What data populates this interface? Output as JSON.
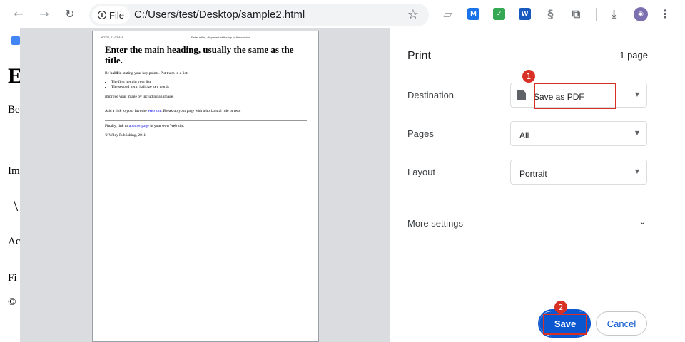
{
  "browser": {
    "back_glyph": "←",
    "forward_glyph": "→",
    "reload_glyph": "↻",
    "chip_label": "File",
    "url": "C:/Users/test/Desktop/sample2.html",
    "star_glyph": "☆",
    "extensions": [
      {
        "name": "eraser-extension-icon",
        "glyph": "▱",
        "color": "#9aa0a6"
      },
      {
        "name": "m-extension-icon",
        "glyph": "M",
        "color": "#1a73e8"
      },
      {
        "name": "check-extension-icon",
        "glyph": "✓",
        "color": "#34a853"
      },
      {
        "name": "word-extension-icon",
        "glyph": "W",
        "color": "#185abd"
      },
      {
        "name": "swirl-extension-icon",
        "glyph": "§",
        "color": "#80868b"
      },
      {
        "name": "puzzle-extension-icon",
        "glyph": "⧉",
        "color": "#5f6368"
      },
      {
        "name": "download-icon",
        "glyph": "⤓",
        "color": "#5f6368"
      },
      {
        "name": "profile-avatar-icon",
        "glyph": "◉",
        "color": "#7b6fb0"
      },
      {
        "name": "menu-kebab-icon",
        "glyph": "⋮",
        "color": "#5f6368"
      }
    ]
  },
  "background_page": {
    "heading_fragment": "E",
    "line1": "Be",
    "line2": "Im",
    "line3": "\\",
    "line4": "Ac",
    "line5": "Fi",
    "line6": "©"
  },
  "preview": {
    "header_left": "6/7/24, 11:02 AM",
    "header_center": "Enter a title, displayed at the top of the window.",
    "heading": "Enter the main heading, usually the same as the title.",
    "p1_pre": "Be ",
    "p1_bold": "bold",
    "p1_post": " in stating your key points. Put them in a list:",
    "list": [
      "The first item in your list",
      "The second item; italicize key words"
    ],
    "p2": "Improve your image by including an image.",
    "p3_pre": "Add a link to your favorite ",
    "p3_link": "Web site",
    "p3_post": ". Break up your page with a horizontal rule or two.",
    "p4_pre": "Finally, link to ",
    "p4_link": "another page",
    "p4_post": " in your own Web site.",
    "copyright": "© Wiley Publishing, 2011"
  },
  "print_panel": {
    "title": "Print",
    "page_count": "1 page",
    "destination_label": "Destination",
    "destination_value": "Save as PDF",
    "pages_label": "Pages",
    "pages_value": "All",
    "layout_label": "Layout",
    "layout_value": "Portrait",
    "more_settings": "More settings",
    "save_label": "Save",
    "cancel_label": "Cancel"
  },
  "annotations": {
    "badge1": "1",
    "badge2": "2",
    "highlight_color": "#d93025"
  }
}
